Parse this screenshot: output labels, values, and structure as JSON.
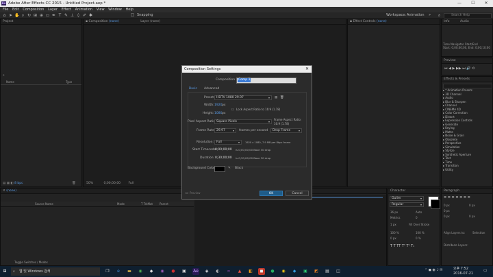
{
  "window": {
    "title": "Adobe After Effects CC 2015 - Untitled Project.aep *",
    "app_icon": "Ae",
    "minimize": "—",
    "maximize": "☐",
    "close": "✕"
  },
  "menu": [
    "File",
    "Edit",
    "Composition",
    "Layer",
    "Effect",
    "Animation",
    "View",
    "Window",
    "Help"
  ],
  "toolbar": {
    "snapping": "Snapping",
    "workspace": "Workspace:",
    "workspace_value": "Animation",
    "search_placeholder": "Search Help"
  },
  "project_panel": {
    "title": "Project",
    "columns": [
      "Name",
      "Type"
    ],
    "footer_bpc": "8 bpc"
  },
  "composition_panel": {
    "tab": "Composition",
    "tab_value": "(none)",
    "layer_tab": "Layer",
    "layer_value": "(none)",
    "zoom": "50%",
    "time": "0;00;00;00",
    "res": "Full"
  },
  "effect_controls": {
    "tab": "Effect Controls",
    "value": "(none)"
  },
  "info_panel": {
    "title": "Info",
    "audio": "Audio",
    "nav_label": "Time Navigator Start/End",
    "nav_start": "Start: 0;00;00;00, End: 0;00;10;00"
  },
  "preview_panel": {
    "title": "Preview"
  },
  "effects_panel": {
    "title": "Effects & Presets",
    "items": [
      "* Animation Presets",
      "3D Channel",
      "Audio",
      "Blur & Sharpen",
      "Channel",
      "CINEMA 4D",
      "Color Correction",
      "Distort",
      "Expression Controls",
      "Generate",
      "Keying",
      "Matte",
      "Noise & Grain",
      "Obsolete",
      "Perspective",
      "Simulation",
      "Stylize",
      "Synthetic Aperture",
      "Text",
      "Time",
      "Transition",
      "Utility"
    ]
  },
  "timeline": {
    "tab": "(none)",
    "columns": [
      "Source Name",
      "Mode",
      "T TrkMat",
      "Parent"
    ],
    "toggle_label": "Toggle Switches / Modes"
  },
  "character_panel": {
    "title": "Character",
    "font": "Gulim",
    "style": "Regular",
    "size": "36 px",
    "leading": "Auto",
    "metrics": "Metrics",
    "tracking": "0",
    "stroke": "1 px",
    "stroke_type": "Fill Over Stroke",
    "vscale": "100 %",
    "hscale": "100 %",
    "baseline": "0 px",
    "tsume": "0 %"
  },
  "paragraph_panel": {
    "title": "Paragraph",
    "indent1": "0 px",
    "indent2": "0 px",
    "indent3": "0 px",
    "space1": "0 px",
    "space2": "0 px",
    "align_label": "Align Layers to:",
    "align_value": "Selection",
    "distribute": "Distribute Layers:"
  },
  "dialog": {
    "title": "Composition Settings",
    "close": "✕",
    "name_label": "Composition Name:",
    "name_value": "Comp 1",
    "tabs": [
      "Basic",
      "Advanced"
    ],
    "preset_label": "Preset:",
    "preset_value": "HDTV 1080 29.97",
    "width_label": "Width:",
    "width_value": "1920",
    "height_label": "Height:",
    "height_value": "1080",
    "px": "px",
    "lock_label": "Lock Aspect Ratio to 16:9 (1.78)",
    "pixel_label": "Pixel Aspect Ratio:",
    "pixel_value": "Square Pixels",
    "frame_aspect_label": "Frame Aspect Ratio:",
    "frame_aspect_value": "16:9 (1.78)",
    "fps_label": "Frame Rate:",
    "fps_value": "29.97",
    "fps_unit": "frames per second",
    "drop_value": "Drop Frame",
    "res_label": "Resolution:",
    "res_value": "Full",
    "res_info": "1920 x 1080, 7.9 MB per 8bpc frame",
    "start_label": "Start Timecode:",
    "start_value": "0;00;00;00",
    "start_info": "is 0;00;00;00  Base 30  drop",
    "dur_label": "Duration:",
    "dur_value": "0;30;00;00",
    "dur_info": "is 0;30;00;00  Base 30  drop",
    "bg_label": "Background Color:",
    "bg_name": "Black",
    "preview": "Preview",
    "ok": "OK",
    "cancel": "Cancel"
  },
  "taskbar": {
    "search": "웹 및 Windows 검색",
    "time": "오후 7:52",
    "date": "2016-07-21"
  },
  "colors": {
    "accent": "#5a9be6",
    "ok_button": "#1f5c89",
    "panel": "#232323"
  }
}
